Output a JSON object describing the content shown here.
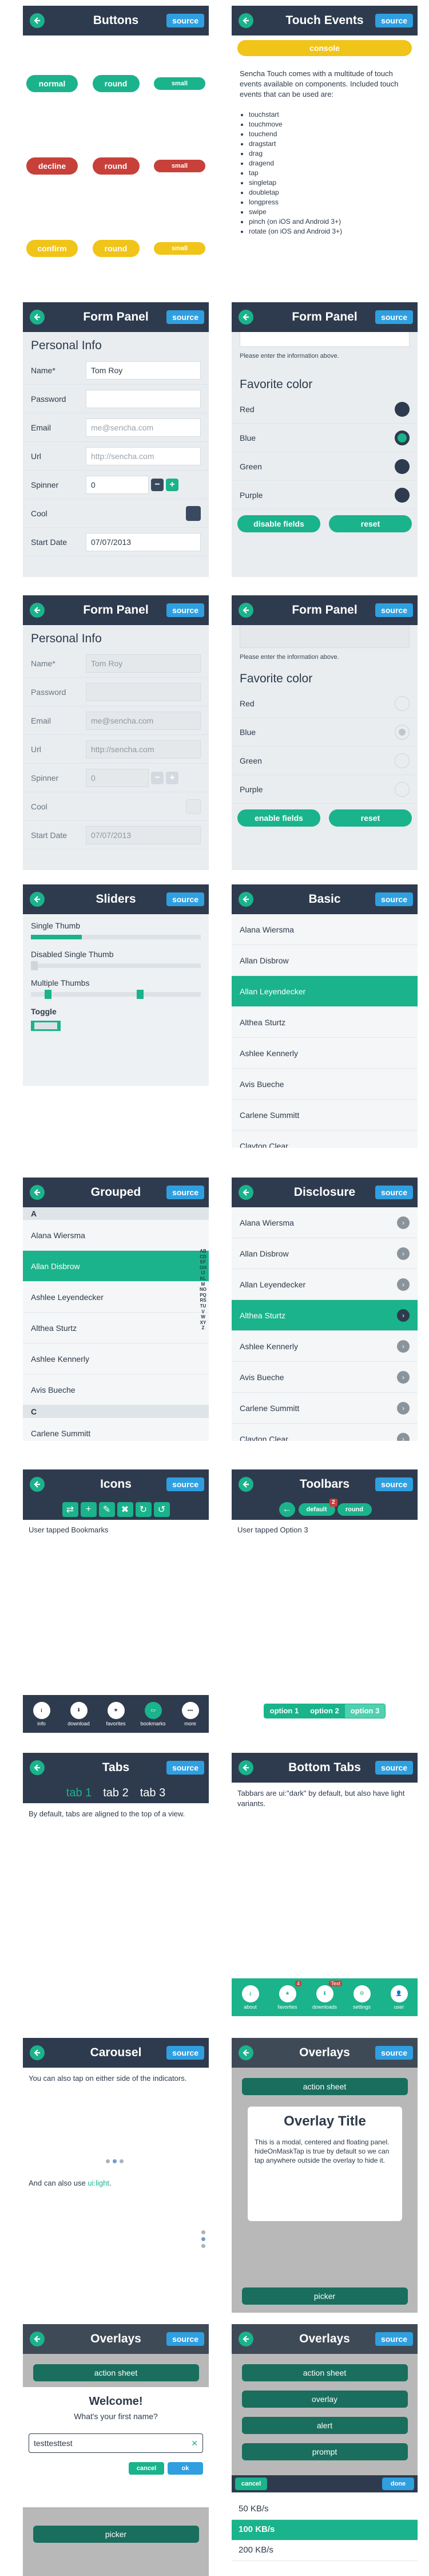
{
  "common": {
    "source_label": "source"
  },
  "buttons": {
    "title": "Buttons",
    "rows": [
      {
        "normal": "normal",
        "round": "round",
        "small": "small",
        "color": "#1ab38c"
      },
      {
        "normal": "decline",
        "round": "round",
        "small": "small",
        "color": "#c8403a"
      },
      {
        "normal": "confirm",
        "round": "round",
        "small": "small",
        "color": "#f0c419"
      }
    ]
  },
  "touch_events": {
    "title": "Touch Events",
    "console_label": "console",
    "description": "Sencha Touch comes with a multitude of touch events available on components. Included touch events that can be used are:",
    "events": [
      "touchstart",
      "touchmove",
      "touchend",
      "dragstart",
      "drag",
      "dragend",
      "tap",
      "singletap",
      "doubletap",
      "longpress",
      "swipe",
      "pinch (on iOS and Android 3+)",
      "rotate (on iOS and Android 3+)"
    ]
  },
  "form_panel": {
    "title": "Form Panel",
    "section": "Personal Info",
    "fields": [
      {
        "label": "Name*",
        "value": "Tom Roy",
        "placeholder": ""
      },
      {
        "label": "Password",
        "value": "",
        "placeholder": ""
      },
      {
        "label": "Email",
        "value": "",
        "placeholder": "me@sencha.com"
      },
      {
        "label": "Url",
        "value": "",
        "placeholder": "http://sencha.com"
      }
    ],
    "spinner_label": "Spinner",
    "spinner_value": "0",
    "cool_label": "Cool",
    "start_date_label": "Start Date",
    "start_date_value": "07/07/2013",
    "note": "Please enter the information above.",
    "favorite_title": "Favorite color",
    "colors": [
      "Red",
      "Blue",
      "Green",
      "Purple"
    ],
    "selected_color": "Blue",
    "disable_label": "disable fields",
    "enable_label": "enable fields",
    "reset_label": "reset"
  },
  "sliders": {
    "title": "Sliders",
    "single": "Single Thumb",
    "single_value": 0.3,
    "disabled": "Disabled Single Thumb",
    "multiple": "Multiple Thumbs",
    "toggle": "Toggle"
  },
  "basic": {
    "title": "Basic",
    "items": [
      "Alana Wiersma",
      "Allan Disbrow",
      "Allan Leyendecker",
      "Althea Sturtz",
      "Ashlee Kennerly",
      "Avis Bueche",
      "Carlene Summitt",
      "Clayton Clear"
    ],
    "selected": 2
  },
  "grouped": {
    "title": "Grouped",
    "header_a": "A",
    "items_a": [
      "Alana Wiersma",
      "Allan Disbrow",
      "Ashlee Leyendecker",
      "Althea Sturtz",
      "Ashlee Kennerly",
      "Avis Bueche"
    ],
    "header_c": "C",
    "items_c": [
      "Carlene Summitt"
    ],
    "index_letters": "ABCDEFGHIJKLMNOPQRSTUVWXYZ"
  },
  "disclosure": {
    "title": "Disclosure",
    "items": [
      "Alana Wiersma",
      "Allan Disbrow",
      "Allan Leyendecker",
      "Althea Sturtz",
      "Ashlee Kennerly",
      "Avis Bueche",
      "Carlene Summitt",
      "Clayton Clear"
    ],
    "selected": 3
  },
  "icons": {
    "title": "Icons",
    "status": "User tapped Bookmarks",
    "tabs": [
      "info",
      "download",
      "favorites",
      "bookmarks",
      "more"
    ]
  },
  "toolbars": {
    "title": "Toolbars",
    "default_label": "default",
    "round_label": "round",
    "badge": "2",
    "status": "User tapped Option 3",
    "options": [
      "option 1",
      "option 2",
      "option 3"
    ]
  },
  "tabs": {
    "title": "Tabs",
    "items": [
      "tab 1",
      "tab 2",
      "tab 3"
    ],
    "description": "By default, tabs are aligned to the top of a view."
  },
  "bottom_tabs": {
    "title": "Bottom Tabs",
    "description": "Tabbars are ui:\"dark\" by default, but also have light variants.",
    "items": [
      "about",
      "favorites",
      "downloads",
      "settings",
      "user"
    ],
    "badge_fav": "4",
    "badge_dl": "Text"
  },
  "carousel": {
    "title": "Carousel",
    "text1": "You can also tap on either side of the indicators.",
    "text2": "And can also use",
    "text2_link": "ui:light"
  },
  "overlays": {
    "title": "Overlays",
    "action_sheet": "action sheet",
    "overlay": "overlay",
    "alert": "alert",
    "prompt": "prompt",
    "picker": "picker",
    "overlay_title": "Overlay Title",
    "overlay_text": "This is a modal, centered and floating panel. hideOnMaskTap is true by default so we can tap anywhere outside the overlay to hide it.",
    "welcome": "Welcome!",
    "question": "What's your first name?",
    "prompt_value": "testtesttest",
    "cancel": "cancel",
    "ok": "ok",
    "done": "done",
    "speeds": [
      "50 KB/s",
      "100 KB/s",
      "200 KB/s"
    ]
  }
}
